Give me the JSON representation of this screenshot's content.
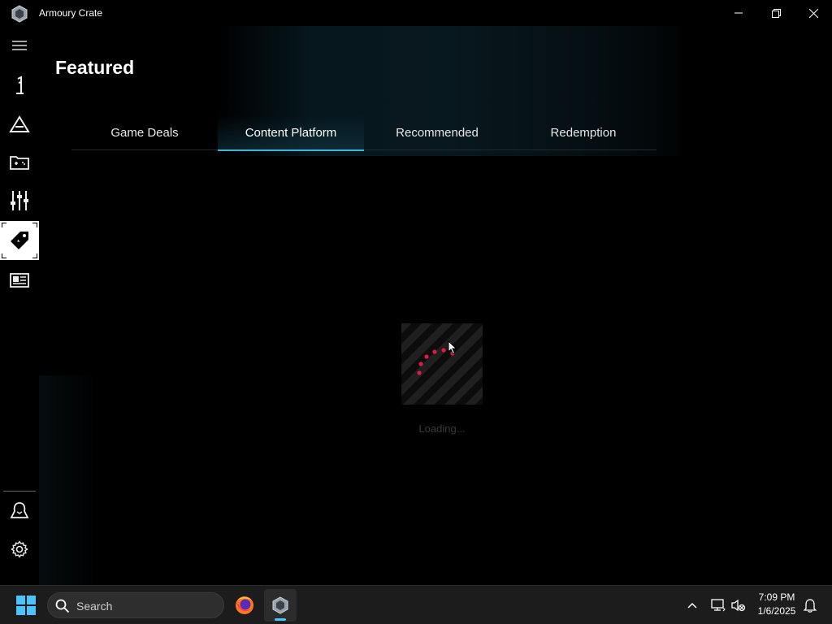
{
  "window": {
    "title": "Armoury Crate",
    "logo_icon": "armoury-crate-logo",
    "controls": [
      "minimize-icon",
      "restore-icon",
      "close-icon"
    ]
  },
  "sidebar": {
    "items": [
      {
        "name": "menu",
        "icon": "hamburger-menu-icon"
      },
      {
        "name": "home",
        "icon": "home-1-icon"
      },
      {
        "name": "aura-sync",
        "icon": "aura-triangle-icon"
      },
      {
        "name": "game-library",
        "icon": "game-library-icon"
      },
      {
        "name": "scenario-profiles",
        "icon": "sliders-icon"
      },
      {
        "name": "featured",
        "icon": "tag-icon",
        "active": true
      },
      {
        "name": "news",
        "icon": "news-icon"
      },
      {
        "name": "user-center",
        "icon": "user-center-icon"
      },
      {
        "name": "settings",
        "icon": "gear-icon"
      }
    ]
  },
  "main": {
    "title": "Featured",
    "tabs": [
      {
        "label": "Game Deals",
        "active": false
      },
      {
        "label": "Content Platform",
        "active": true
      },
      {
        "label": "Recommended",
        "active": false
      },
      {
        "label": "Redemption",
        "active": false
      }
    ],
    "loading_text": "Loading..."
  },
  "colors": {
    "accent": "#3fb4d8",
    "loader_dots": "#e0194a"
  },
  "taskbar": {
    "search_placeholder": "Search",
    "apps": [
      "firefox-icon",
      "armoury-crate-icon"
    ],
    "tray_icons": [
      "chevron-up-icon",
      "network-icon",
      "speaker-muted-icon",
      "notification-bell-icon"
    ],
    "time": "7:09 PM",
    "date": "1/6/2025"
  }
}
